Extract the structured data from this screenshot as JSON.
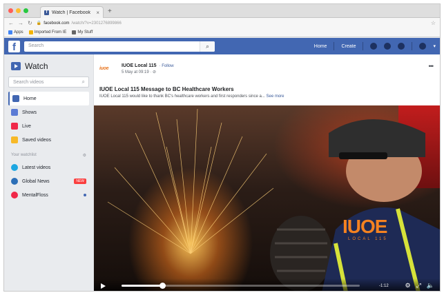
{
  "browser": {
    "tab_title": "Watch | Facebook",
    "tab_close": "×",
    "new_tab": "+",
    "url_host": "facebook.com",
    "url_path": "/watch/?v=2301276899866",
    "bookmarks": [
      "Apps",
      "Imported From IE",
      "My Stuff"
    ]
  },
  "header": {
    "logo": "f",
    "search_placeholder": "Search",
    "nav": [
      "Home",
      "Create"
    ]
  },
  "sidebar": {
    "title": "Watch",
    "search_placeholder": "Search videos",
    "items": [
      {
        "label": "Home",
        "color": "#4267b2",
        "active": true
      },
      {
        "label": "Shows",
        "color": "#5b7bd5"
      },
      {
        "label": "Live",
        "color": "#f02849"
      },
      {
        "label": "Saved videos",
        "color": "#f7b928"
      }
    ],
    "section_label": "Your watchlist",
    "section_icon": "gear-icon",
    "watchlist": [
      {
        "label": "Latest videos",
        "color": "#1ea7e1",
        "extra": ""
      },
      {
        "label": "Global News",
        "color": "#2c6fb7",
        "extra": "NEW"
      },
      {
        "label": "MentalFloss",
        "color": "#f02849",
        "extra": "dot"
      }
    ]
  },
  "post": {
    "page_logo": "iuoe",
    "page_name": "IUOE Local 115",
    "follow": "· Follow",
    "date": "5 May at 09:19 · ⊘",
    "title": "IUOE Local 115 Message to BC Healthcare Workers",
    "description": "IUOE Local 115 would like to thank BC's healthcare workers and first responders since a...",
    "see_more": "See more",
    "more_icon": "•••"
  },
  "video": {
    "brand": "IUOE",
    "brand_sub": "LOCAL 115",
    "progress": 0.17,
    "time": "-1:12",
    "icons": [
      "gear-icon",
      "expand-icon",
      "volume-icon"
    ]
  }
}
